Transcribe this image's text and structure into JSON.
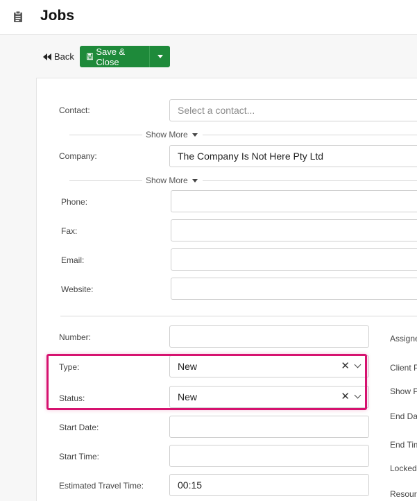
{
  "header": {
    "title": "Jobs",
    "icon": "clipboard-icon"
  },
  "toolbar": {
    "back_label": "Back",
    "save_label": "Save & Close"
  },
  "form": {
    "contact": {
      "label": "Contact:",
      "placeholder": "Select a contact..."
    },
    "show_more_1": "Show More",
    "company": {
      "label": "Company:",
      "value": "The Company Is Not Here Pty Ltd"
    },
    "show_more_2": "Show More",
    "phone": {
      "label": "Phone:",
      "value": ""
    },
    "fax": {
      "label": "Fax:",
      "value": ""
    },
    "email": {
      "label": "Email:",
      "value": ""
    },
    "website": {
      "label": "Website:",
      "value": ""
    },
    "number": {
      "label": "Number:",
      "value": ""
    },
    "type": {
      "label": "Type:",
      "value": "New"
    },
    "status": {
      "label": "Status:",
      "value": "New"
    },
    "start_date": {
      "label": "Start Date:",
      "value": ""
    },
    "start_time": {
      "label": "Start Time:",
      "value": ""
    },
    "travel_time": {
      "label": "Estimated Travel Time:",
      "value": "00:15"
    }
  },
  "right_labels": [
    "Assigne",
    "Client P",
    "Show P",
    "End Da",
    "End Tim",
    "Locked:",
    "Resour"
  ],
  "colors": {
    "save_green": "#1e8a3a",
    "highlight": "#d6126f"
  }
}
